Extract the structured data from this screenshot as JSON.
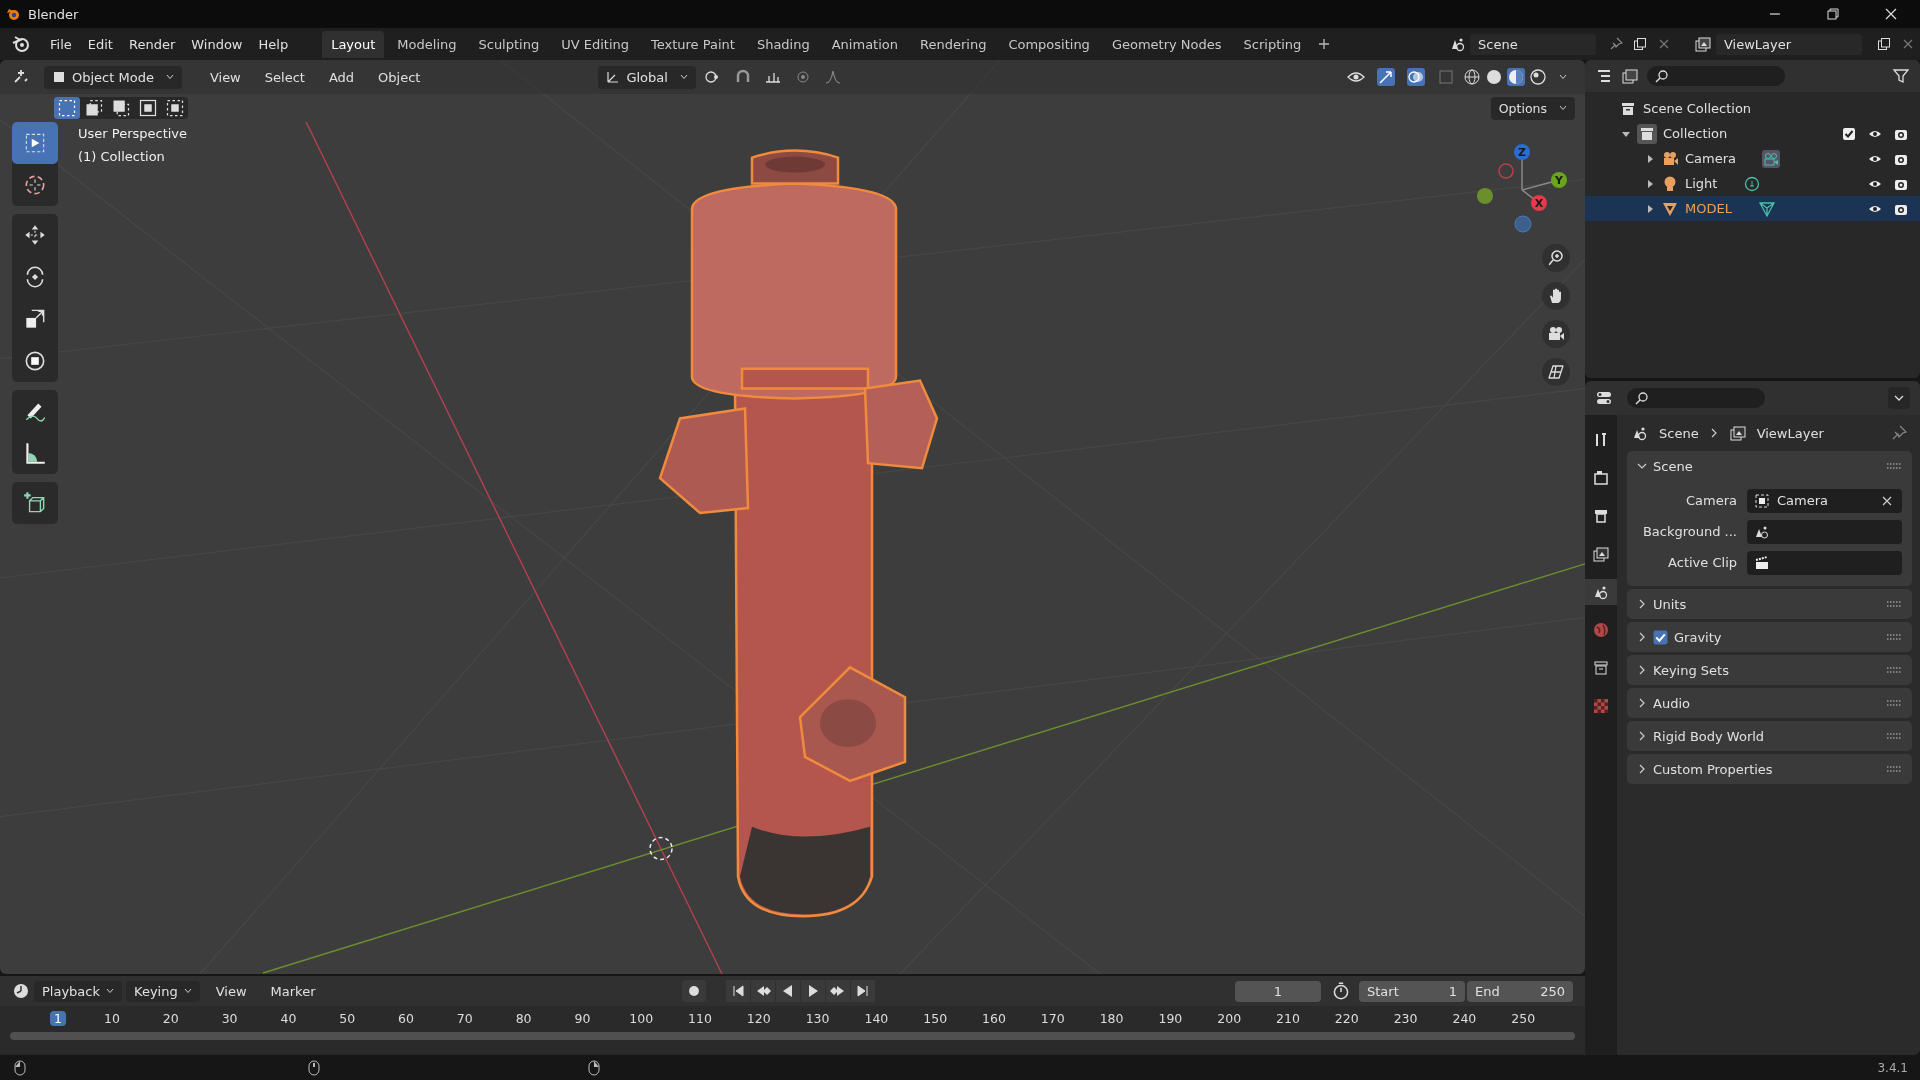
{
  "window": {
    "title": "Blender"
  },
  "menu": [
    "File",
    "Edit",
    "Render",
    "Window",
    "Help"
  ],
  "workspaces": [
    {
      "label": "Layout",
      "selected": true
    },
    {
      "label": "Modeling",
      "selected": false
    },
    {
      "label": "Sculpting",
      "selected": false
    },
    {
      "label": "UV Editing",
      "selected": false
    },
    {
      "label": "Texture Paint",
      "selected": false
    },
    {
      "label": "Shading",
      "selected": false
    },
    {
      "label": "Animation",
      "selected": false
    },
    {
      "label": "Rendering",
      "selected": false
    },
    {
      "label": "Compositing",
      "selected": false
    },
    {
      "label": "Geometry Nodes",
      "selected": false
    },
    {
      "label": "Scripting",
      "selected": false
    }
  ],
  "scene": "Scene",
  "view_layer": "ViewLayer",
  "viewport": {
    "mode": "Object Mode",
    "menus": [
      "View",
      "Select",
      "Add",
      "Object"
    ],
    "orientation": "Global",
    "options": "Options",
    "info": [
      "User Perspective",
      "(1) Collection"
    ],
    "gizmo_axes": [
      "X",
      "Y",
      "Z"
    ],
    "tool_groups": [
      [
        {
          "kind": "select",
          "selected": true
        },
        {
          "kind": "cursor",
          "selected": false
        }
      ],
      [
        {
          "kind": "move",
          "selected": false
        },
        {
          "kind": "rotate",
          "selected": false
        },
        {
          "kind": "scale",
          "selected": false
        },
        {
          "kind": "transform",
          "selected": false
        }
      ],
      [
        {
          "kind": "annotate",
          "selected": false
        },
        {
          "kind": "measure",
          "selected": false
        }
      ],
      [
        {
          "kind": "add-cube",
          "selected": false
        }
      ]
    ]
  },
  "outliner": {
    "root": "Scene Collection",
    "collections": [
      {
        "label": "Collection",
        "expanded": true,
        "checked": true,
        "children": [
          {
            "label": "Camera",
            "kind": "camera",
            "selected": false
          },
          {
            "label": "Light",
            "kind": "light",
            "selected": false
          },
          {
            "label": "MODEL",
            "kind": "mesh",
            "selected": true
          }
        ]
      }
    ]
  },
  "properties": {
    "breadcrumb": [
      "Scene",
      "ViewLayer"
    ],
    "panels": [
      {
        "title": "Scene",
        "expanded": true,
        "fields": [
          {
            "label": "Camera",
            "kind": "camera",
            "value": "Camera"
          },
          {
            "label": "Background ...",
            "kind": "scene"
          },
          {
            "label": "Active Clip",
            "kind": "clip"
          }
        ]
      },
      {
        "title": "Units",
        "expanded": false
      },
      {
        "title": "Gravity",
        "expanded": false,
        "checked": true
      },
      {
        "title": "Keying Sets",
        "expanded": false
      },
      {
        "title": "Audio",
        "expanded": false
      },
      {
        "title": "Rigid Body World",
        "expanded": false
      },
      {
        "title": "Custom Properties",
        "expanded": false
      }
    ]
  },
  "timeline": {
    "menus": [
      "Playback",
      "Keying",
      "View",
      "Marker"
    ],
    "current_frame": "1",
    "start_label": "Start",
    "start": "1",
    "end_label": "End",
    "end": "250",
    "ruler": [
      {
        "label": "1",
        "selected": true
      },
      {
        "label": "10",
        "selected": false
      },
      {
        "label": "20",
        "selected": false
      },
      {
        "label": "30",
        "selected": false
      },
      {
        "label": "40",
        "selected": false
      },
      {
        "label": "50",
        "selected": false
      },
      {
        "label": "60",
        "selected": false
      },
      {
        "label": "70",
        "selected": false
      },
      {
        "label": "80",
        "selected": false
      },
      {
        "label": "90",
        "selected": false
      },
      {
        "label": "100",
        "selected": false
      },
      {
        "label": "110",
        "selected": false
      },
      {
        "label": "120",
        "selected": false
      },
      {
        "label": "130",
        "selected": false
      },
      {
        "label": "140",
        "selected": false
      },
      {
        "label": "150",
        "selected": false
      },
      {
        "label": "160",
        "selected": false
      },
      {
        "label": "170",
        "selected": false
      },
      {
        "label": "180",
        "selected": false
      },
      {
        "label": "190",
        "selected": false
      },
      {
        "label": "200",
        "selected": false
      },
      {
        "label": "210",
        "selected": false
      },
      {
        "label": "220",
        "selected": false
      },
      {
        "label": "230",
        "selected": false
      },
      {
        "label": "240",
        "selected": false
      },
      {
        "label": "250",
        "selected": false
      }
    ]
  },
  "status_bar": {
    "version": "3.4.1"
  }
}
